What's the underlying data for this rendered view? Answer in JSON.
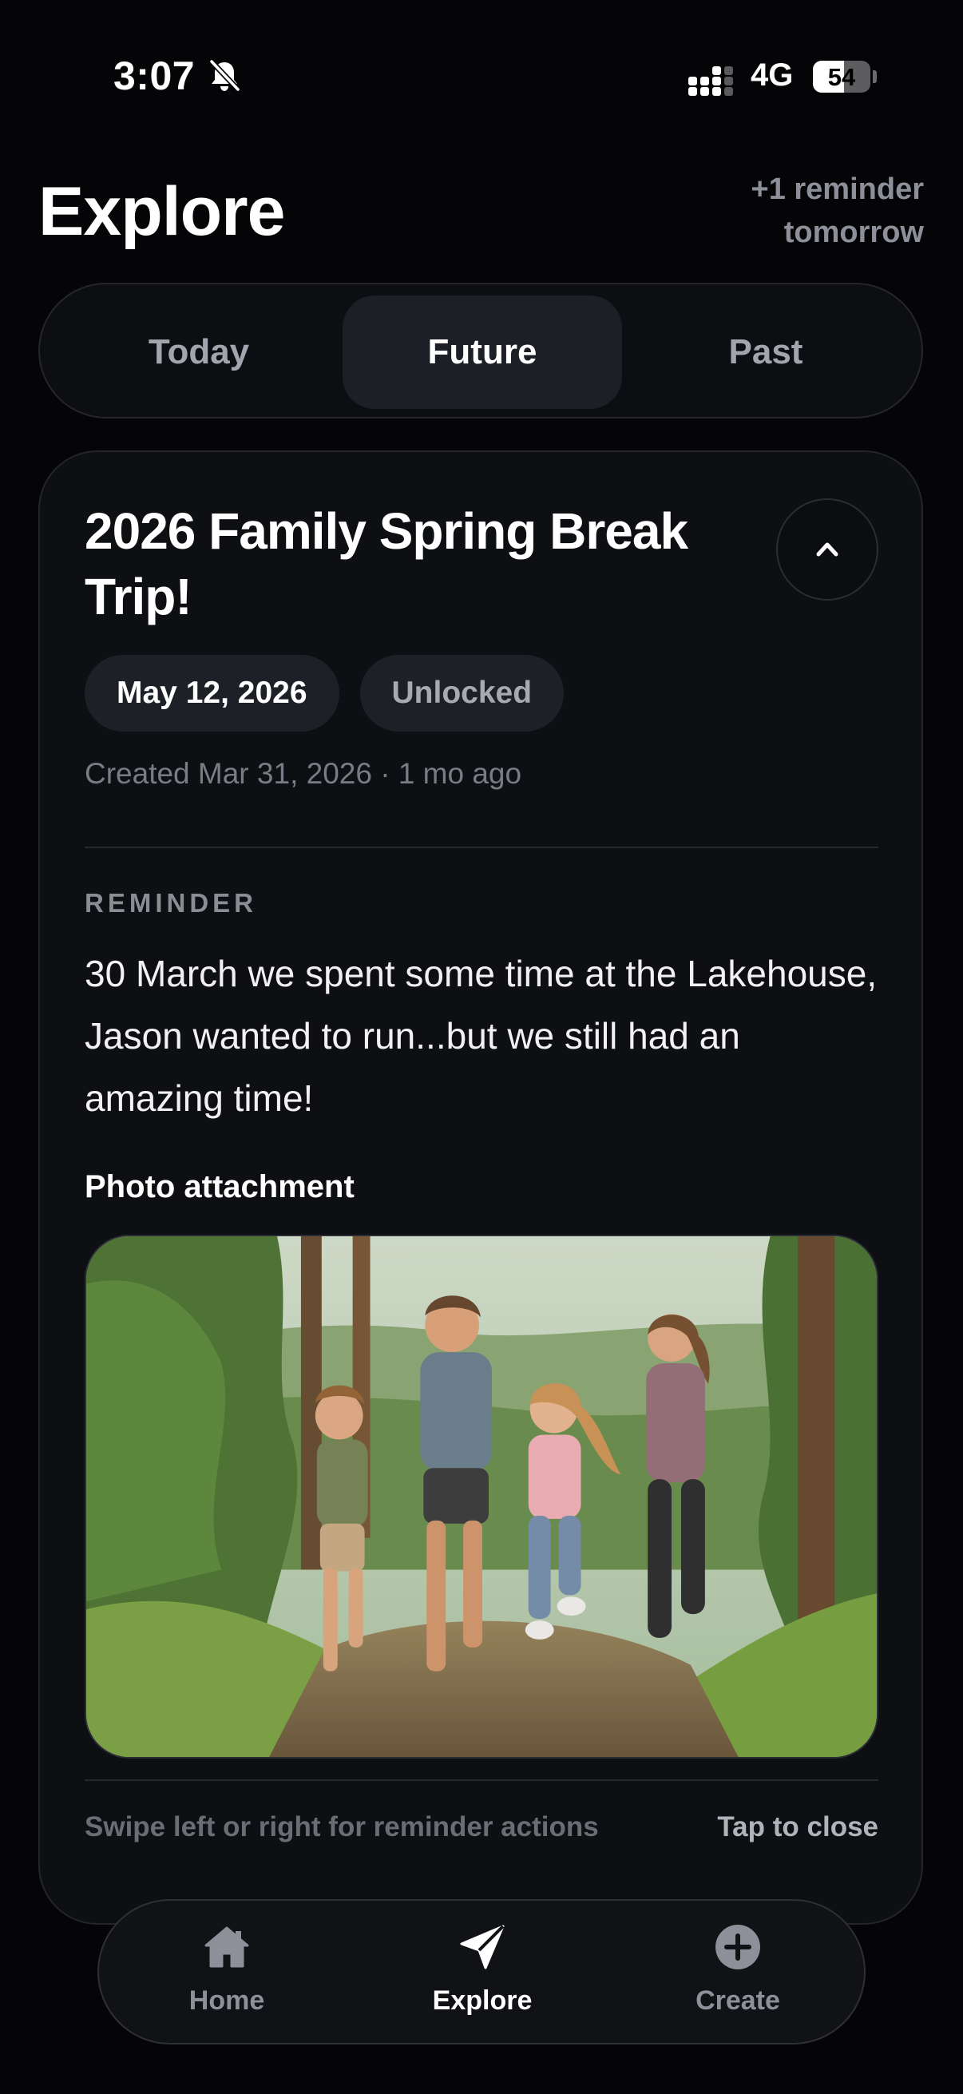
{
  "status_bar": {
    "time": "3:07",
    "network": "4G",
    "battery_percent": "54",
    "battery_level": 0.54,
    "icons": [
      "bell-slash-icon",
      "signal-icon",
      "battery-icon"
    ]
  },
  "header": {
    "title": "Explore",
    "note_line1": "+1 reminder",
    "note_line2": "tomorrow"
  },
  "tabs": {
    "items": [
      {
        "label": "Today",
        "active": false
      },
      {
        "label": "Future",
        "active": true
      },
      {
        "label": "Past",
        "active": false
      }
    ]
  },
  "card": {
    "title": "2026 Family Spring Break Trip!",
    "date_chip": "May 12, 2026",
    "status_chip": "Unlocked",
    "created": "Created Mar 31, 2026 · 1 mo ago",
    "section_label": "REMINDER",
    "body": "30 March we spent some time at the Lakehouse, Jason wanted to run...but we still had an amazing time!",
    "photo_label": "Photo attachment",
    "photo_icon": "photo-family-running-forest-trail",
    "footer_hint": "Swipe left or right for reminder actions",
    "footer_close": "Tap to close",
    "collapse_icon": "chevron-up-icon"
  },
  "nav": {
    "items": [
      {
        "label": "Home",
        "icon": "home-icon",
        "active": false
      },
      {
        "label": "Explore",
        "icon": "send-icon",
        "active": true
      },
      {
        "label": "Create",
        "icon": "plus-circle-icon",
        "active": false
      }
    ]
  },
  "colors": {
    "background": "#050507",
    "card": "#0e0f12",
    "active_tab": "#1c1f26",
    "muted_text": "#8d9099"
  }
}
